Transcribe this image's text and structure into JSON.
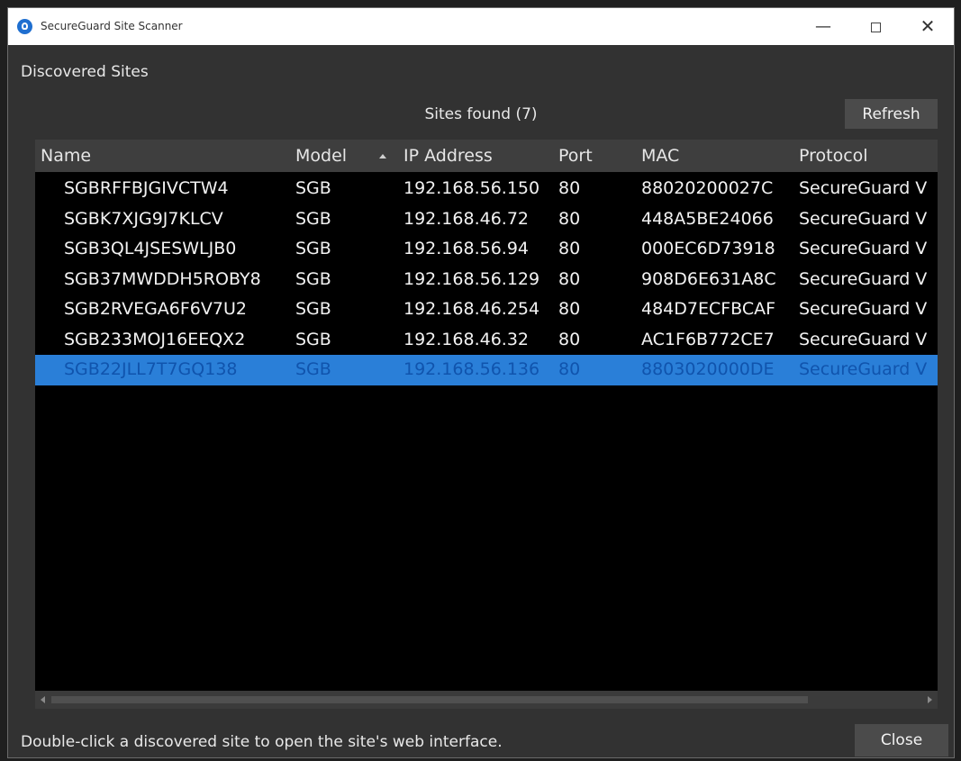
{
  "window": {
    "title": "SecureGuard Site Scanner",
    "minimize_glyph": "—",
    "close_glyph": "✕"
  },
  "section_title": "Discovered Sites",
  "sites_found": "Sites found (7)",
  "refresh_label": "Refresh",
  "table": {
    "headers": {
      "name": "Name",
      "model": "Model",
      "ip": "IP Address",
      "port": "Port",
      "mac": "MAC",
      "protocol": "Protocol"
    },
    "sort_column": "ip",
    "rows": [
      {
        "name": "SGBRFFBJGIVCTW4",
        "model": "SGB",
        "ip": "192.168.56.150",
        "port": "80",
        "mac": "88020200027C",
        "protocol": "SecureGuard V"
      },
      {
        "name": "SGBK7XJG9J7KLCV",
        "model": "SGB",
        "ip": "192.168.46.72",
        "port": "80",
        "mac": "448A5BE24066",
        "protocol": "SecureGuard V"
      },
      {
        "name": "SGB3QL4JSESWLJB0",
        "model": "SGB",
        "ip": "192.168.56.94",
        "port": "80",
        "mac": "000EC6D73918",
        "protocol": "SecureGuard V"
      },
      {
        "name": "SGB37MWDDH5ROBY8",
        "model": "SGB",
        "ip": "192.168.56.129",
        "port": "80",
        "mac": "908D6E631A8C",
        "protocol": "SecureGuard V"
      },
      {
        "name": "SGB2RVEGA6F6V7U2",
        "model": "SGB",
        "ip": "192.168.46.254",
        "port": "80",
        "mac": "484D7ECFBCAF",
        "protocol": "SecureGuard V"
      },
      {
        "name": "SGB233MOJ16EEQX2",
        "model": "SGB",
        "ip": "192.168.46.32",
        "port": "80",
        "mac": "AC1F6B772CE7",
        "protocol": "SecureGuard V"
      },
      {
        "name": "SGB22JLL7T7GQ138",
        "model": "SGB",
        "ip": "192.168.56.136",
        "port": "80",
        "mac": "8803020000DE",
        "protocol": "SecureGuard V"
      }
    ],
    "selected_row": 6
  },
  "status_text": "Double-click a discovered site to open the site's web interface.",
  "close_label": "Close",
  "colors": {
    "selection": "#2a7fd8",
    "window_bg": "#323232",
    "table_bg": "#000000"
  }
}
